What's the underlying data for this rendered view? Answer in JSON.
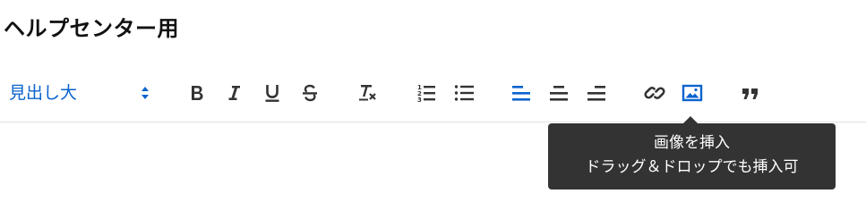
{
  "page": {
    "title": "ヘルプセンター用"
  },
  "toolbar": {
    "heading_select": {
      "value": "見出し大"
    },
    "buttons": [
      {
        "name": "bold",
        "icon": "bold-icon"
      },
      {
        "name": "italic",
        "icon": "italic-icon"
      },
      {
        "name": "underline",
        "icon": "underline-icon"
      },
      {
        "name": "strikethrough",
        "icon": "strikethrough-icon"
      },
      {
        "name": "clear-format",
        "icon": "clear-format-icon"
      },
      {
        "name": "ordered-list",
        "icon": "ordered-list-icon"
      },
      {
        "name": "bullet-list",
        "icon": "bullet-list-icon"
      },
      {
        "name": "align-left",
        "icon": "align-left-icon",
        "active": true
      },
      {
        "name": "align-center",
        "icon": "align-center-icon"
      },
      {
        "name": "align-right",
        "icon": "align-right-icon"
      },
      {
        "name": "link",
        "icon": "link-icon"
      },
      {
        "name": "image",
        "icon": "image-icon",
        "active": true
      },
      {
        "name": "quote",
        "icon": "quote-icon"
      }
    ]
  },
  "tooltip": {
    "line1": "画像を挿入",
    "line2": "ドラッグ＆ドロップでも挿入可"
  },
  "colors": {
    "accent": "#0b63ce",
    "icon": "#333333",
    "tooltip_bg": "#333333",
    "divider": "#e2e2e2"
  }
}
